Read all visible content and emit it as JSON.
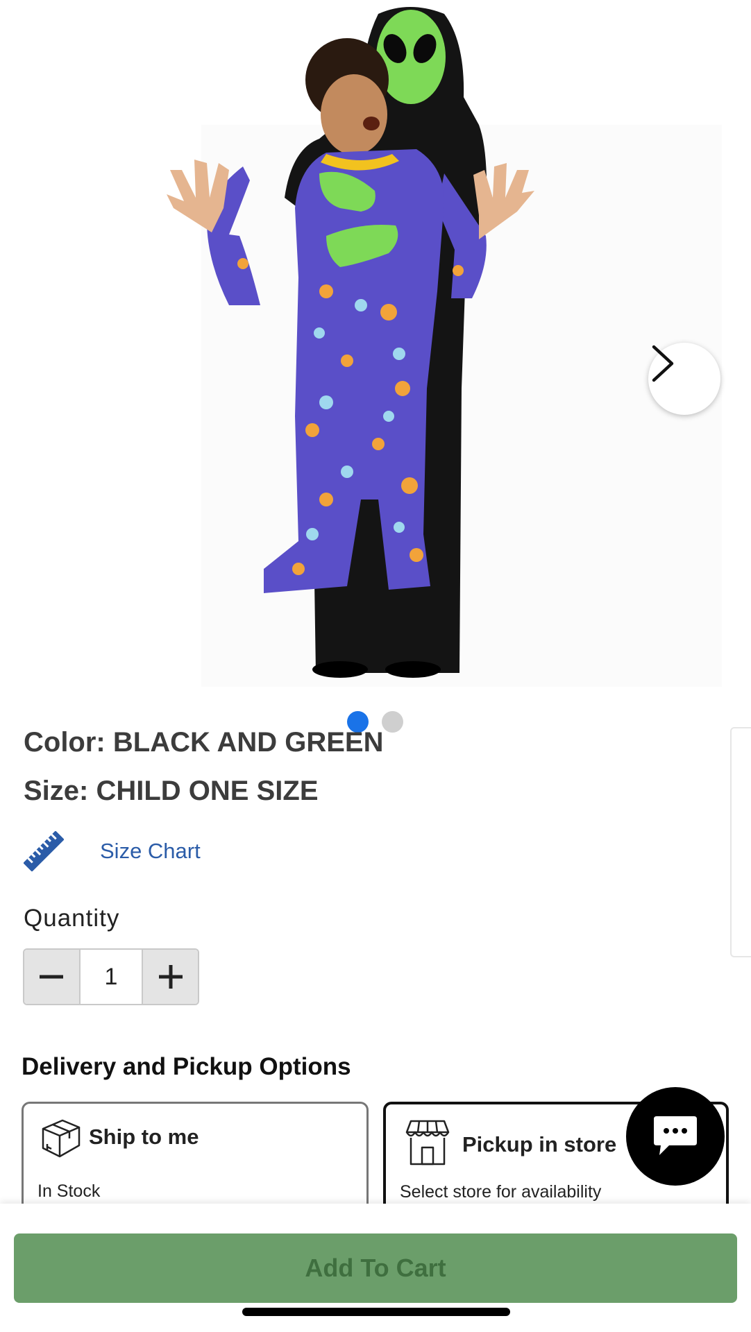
{
  "hero": {
    "image_alt": "Alien Abduction child costume product photo",
    "next_icon": "chevron-right-icon",
    "dots": [
      {
        "active": true,
        "color": "#1a73e8"
      },
      {
        "active": false,
        "color": "#cfcfcf"
      }
    ]
  },
  "product": {
    "color_label": "Color: BLACK AND GREEN",
    "size_label": "Size: CHILD ONE SIZE",
    "size_chart": {
      "icon": "ruler-icon",
      "label": "Size Chart",
      "color": "#2b5ca8"
    }
  },
  "quantity": {
    "label": "Quantity",
    "value": "1",
    "decrement_icon": "minus-icon",
    "increment_icon": "plus-icon"
  },
  "delivery": {
    "heading": "Delivery and Pickup Options",
    "options": [
      {
        "icon": "box-icon",
        "title": "Ship to me",
        "subtitle": "In Stock",
        "selected": false
      },
      {
        "icon": "store-icon",
        "title": "Pickup in store",
        "subtitle": "Select store for availability",
        "selected": true
      }
    ]
  },
  "chat": {
    "icon": "chat-bubble-icon"
  },
  "footer": {
    "add_to_cart_label": "Add To Cart",
    "button_color": "#6b9e6a"
  }
}
